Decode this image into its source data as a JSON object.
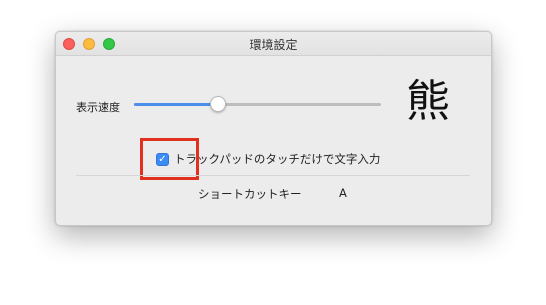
{
  "window": {
    "title": "環境設定"
  },
  "display_speed": {
    "label": "表示速度",
    "value_fraction": 0.34
  },
  "preview": {
    "character": "熊"
  },
  "trackpad_option": {
    "label": "トラックパッドのタッチだけで文字入力",
    "checked": true,
    "check_glyph": "✓"
  },
  "shortcut": {
    "label": "ショートカットキー",
    "key": "A"
  },
  "colors": {
    "accent": "#3d8cf5",
    "highlight": "#e0301e"
  }
}
